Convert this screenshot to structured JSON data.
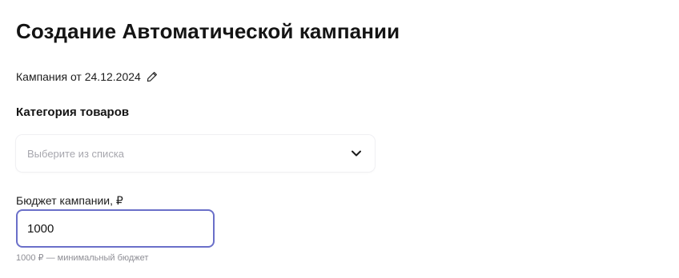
{
  "header": {
    "title": "Создание Автоматической кампании"
  },
  "campaign": {
    "name": "Кампания от 24.12.2024",
    "edit_icon": "pencil-icon"
  },
  "category": {
    "label": "Категория товаров",
    "placeholder": "Выберите из списка",
    "chevron_icon": "chevron-down-icon"
  },
  "budget": {
    "label": "Бюджет кампании, ₽",
    "value": "1000",
    "hint": "1000 ₽ — минимальный бюджет"
  },
  "colors": {
    "focus_border": "#6a6fc9",
    "placeholder": "#a7a7ae",
    "hint": "#8e8e95"
  }
}
